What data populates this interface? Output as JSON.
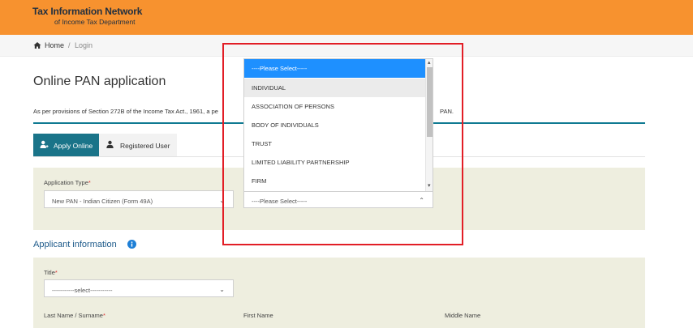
{
  "header": {
    "brand_line1": "Tax Information Network",
    "brand_line2": "of Income Tax Department"
  },
  "breadcrumb": {
    "home": "Home",
    "separator": "/",
    "current": "Login"
  },
  "page": {
    "title": "Online PAN application",
    "provision_text": "As per provisions of Section 272B of the Income Tax Act., 1961, a pe",
    "provision_end": "PAN."
  },
  "tabs": [
    {
      "label": "Apply Online",
      "active": true
    },
    {
      "label": "Registered User",
      "active": false
    }
  ],
  "application_type": {
    "label": "Application Type",
    "required_mark": "*",
    "value": "New PAN - Indian Citizen (Form 49A)"
  },
  "category": {
    "value": "----Please Select-----",
    "options": [
      "----Please Select-----",
      "INDIVIDUAL",
      "ASSOCIATION OF PERSONS",
      "BODY OF INDIVIDUALS",
      "TRUST",
      "LIMITED LIABILITY PARTNERSHIP",
      "FIRM"
    ],
    "highlighted_index": 0,
    "hover_index": 1
  },
  "applicant": {
    "heading": "Applicant information",
    "title_label": "Title",
    "required_mark": "*",
    "title_value": "-----------select-----------",
    "last_name_label": "Last Name / Surname",
    "first_name_label": "First Name",
    "middle_name_label": "Middle Name"
  },
  "icons": {
    "home": "home-icon",
    "apply": "apply-user-icon",
    "registered": "registered-user-icon",
    "info": "info-icon",
    "chevron": "chevron-down-icon"
  },
  "colors": {
    "header": "#f7922f",
    "accent_teal": "#1a7489",
    "highlight_option": "#1e90ff",
    "panel_bg": "#eeeedf",
    "annotation_red": "#e21e26",
    "link_blue": "#1d5a8a"
  }
}
